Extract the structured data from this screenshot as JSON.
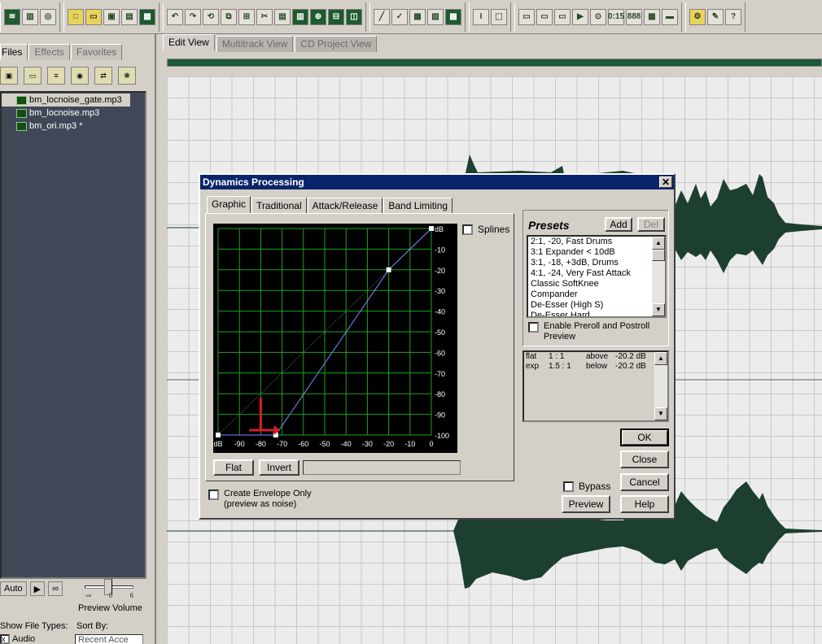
{
  "view_tabs": [
    {
      "label": "Edit View",
      "active": true
    },
    {
      "label": "Multitrack View",
      "active": false
    },
    {
      "label": "CD Project View",
      "active": false
    }
  ],
  "left_panel": {
    "tabs": [
      {
        "label": "Files",
        "active": true
      },
      {
        "label": "Effects",
        "active": false
      },
      {
        "label": "Favorites",
        "active": false
      }
    ],
    "files": [
      {
        "name": "bm_locnoise_gate.mp3",
        "selected": true
      },
      {
        "name": "bm_locnoise.mp3",
        "selected": false
      },
      {
        "name": "bm_ori.mp3 *",
        "selected": false
      }
    ],
    "auto_label": "Auto",
    "preview_volume_label": "Preview Volume",
    "volume_ticks": [
      "-∞",
      "0",
      "6"
    ],
    "show_file_types_label": "Show File Types:",
    "sort_by_label": "Sort By:",
    "audio_label": "Audio",
    "sort_value": "Recent Acce"
  },
  "dialog": {
    "title": "Dynamics Processing",
    "tabs": [
      {
        "label": "Graphic",
        "active": true
      },
      {
        "label": "Traditional",
        "active": false
      },
      {
        "label": "Attack/Release",
        "active": false
      },
      {
        "label": "Band Limiting",
        "active": false
      }
    ],
    "splines_label": "Splines",
    "flat_label": "Flat",
    "invert_label": "Invert",
    "create_envelope_label": "Create Envelope Only",
    "create_envelope_sub": "(preview as noise)",
    "presets_title": "Presets",
    "add_label": "Add",
    "del_label": "Del",
    "presets": [
      "2:1, -20, Fast Drums",
      "3:1 Expander < 10dB",
      "3:1, -18, +3dB, Drums",
      "4:1, -24, Very Fast Attack",
      "Classic SoftKnee",
      "Compander",
      "De-Esser (High S)",
      "De-Esser Hard"
    ],
    "enable_preroll_label": "Enable Preroll and Postroll",
    "enable_preroll_sub": "Preview",
    "info_rows": [
      [
        "flat",
        "1 : 1",
        "above",
        "-20.2 dB"
      ],
      [
        "exp",
        "1.5 : 1",
        "below",
        "-20.2 dB"
      ]
    ],
    "ok_label": "OK",
    "close_label": "Close",
    "cancel_label": "Cancel",
    "help_label": "Help",
    "preview_label": "Preview",
    "bypass_label": "Bypass",
    "graph": {
      "x_ticks": [
        "dB",
        "-90",
        "-80",
        "-70",
        "-60",
        "-50",
        "-40",
        "-30",
        "-20",
        "-10",
        "0"
      ],
      "y_ticks": [
        "dB",
        "-10",
        "-20",
        "-30",
        "-40",
        "-50",
        "-60",
        "-70",
        "-80",
        "-90",
        "-100"
      ],
      "curve_points_db": [
        [
          -100,
          -100
        ],
        [
          -73,
          -100
        ],
        [
          -20,
          -20
        ],
        [
          0,
          0
        ]
      ],
      "colors": {
        "grid": "#1fa31f",
        "curve": "#7a8cff",
        "diagonal": "#6a8c6a",
        "bg": "#000000",
        "arrow": "#d4202a"
      }
    }
  }
}
